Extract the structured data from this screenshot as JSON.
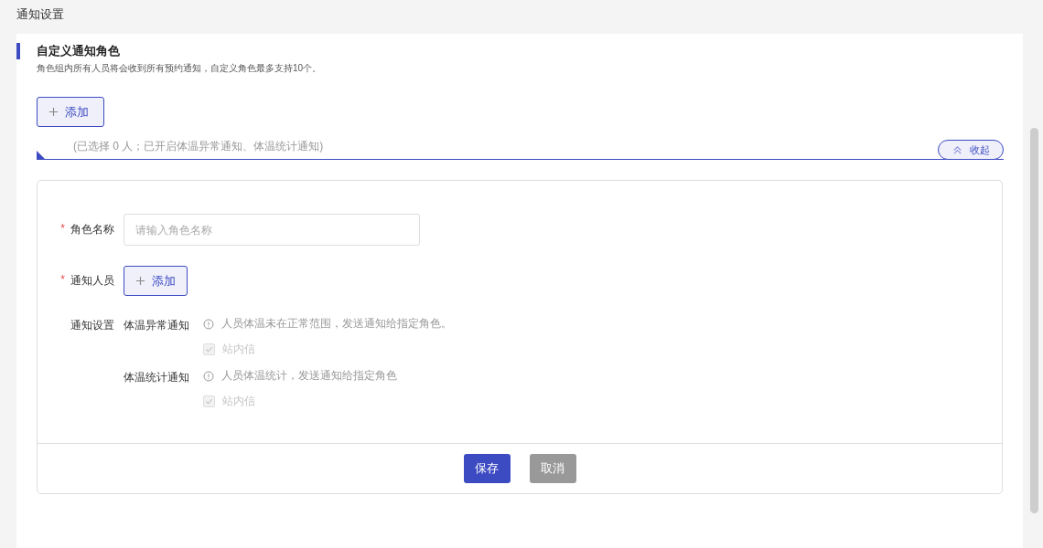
{
  "page_title": "通知设置",
  "section": {
    "title": "自定义通知角色",
    "description": "角色组内所有人员将会收到所有预约通知，自定义角色最多支持10个。",
    "add_button": "添加"
  },
  "role": {
    "summary": "(已选择 0 人；已开启体温异常通知、体温统计通知)",
    "collapse_button": "收起",
    "expanded": true
  },
  "form": {
    "fields": [
      {
        "kind": "input",
        "label": "角色名称",
        "required_mark": "*",
        "placeholder": "请输入角色名称"
      },
      {
        "kind": "button",
        "label": "通知人员",
        "required_mark": "*",
        "button": "添加"
      }
    ],
    "settings_label": "通知设置",
    "settings": [
      {
        "name": "体温异常通知",
        "hint": "人员体温未在正常范围，发送通知给指定角色。",
        "channel": "站内信",
        "checked": true,
        "disabled": true
      },
      {
        "name": "体温统计通知",
        "hint": "人员体温统计，发送通知给指定角色",
        "channel": "站内信",
        "checked": true,
        "disabled": true
      }
    ]
  },
  "buttons": [
    {
      "label": "保存",
      "kind": "primary"
    },
    {
      "label": "取消",
      "kind": "secondary"
    }
  ]
}
